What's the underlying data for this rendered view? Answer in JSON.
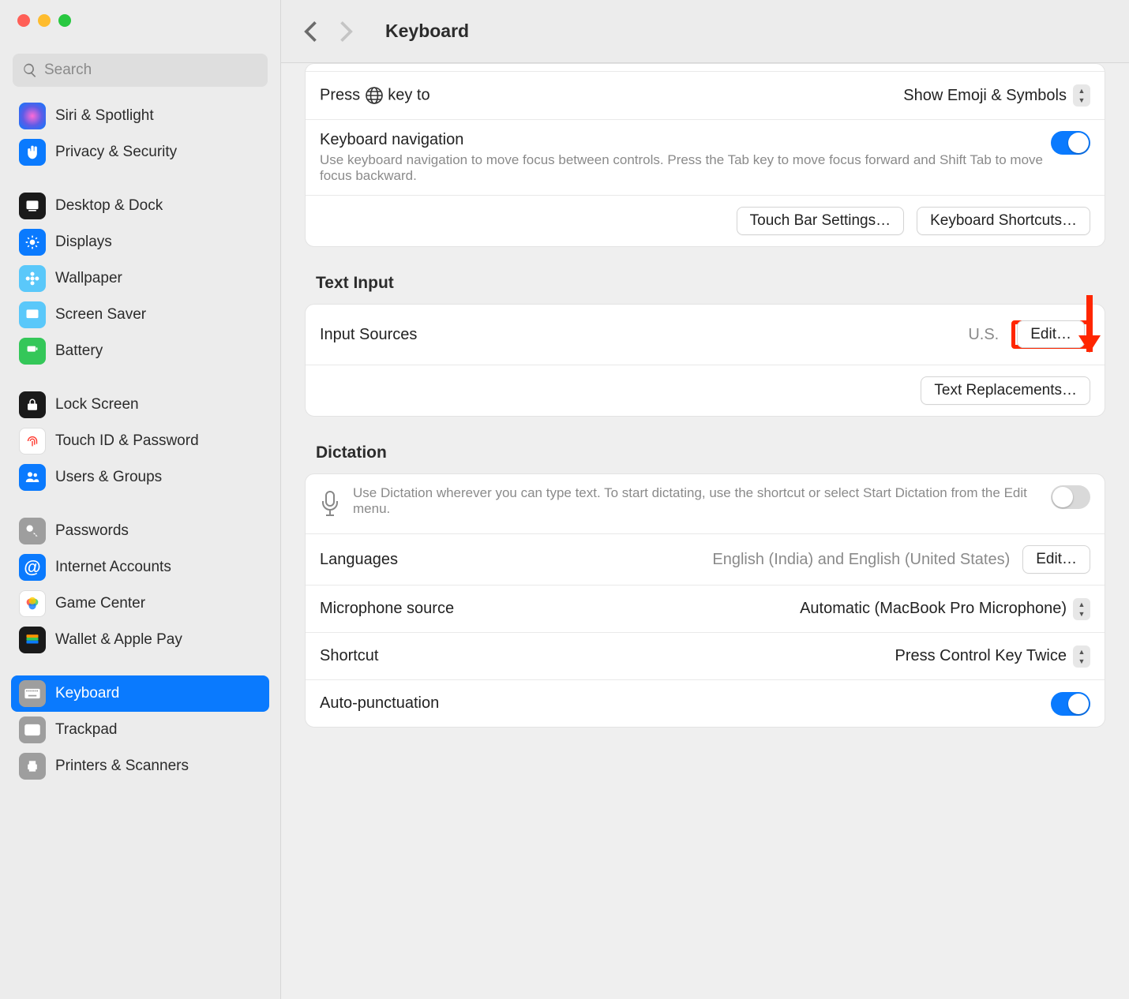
{
  "window": {
    "title": "Keyboard"
  },
  "search": {
    "placeholder": "Search"
  },
  "sidebar": {
    "groups": [
      [
        {
          "label": "Siri & Spotlight",
          "iconColor": "#1a1a1a",
          "icon": "siri"
        },
        {
          "label": "Privacy & Security",
          "iconColor": "#0a7afe",
          "icon": "hand"
        }
      ],
      [
        {
          "label": "Desktop & Dock",
          "iconColor": "#1a1a1a",
          "icon": "dock"
        },
        {
          "label": "Displays",
          "iconColor": "#0a7afe",
          "icon": "sun"
        },
        {
          "label": "Wallpaper",
          "iconColor": "#5ac8fa",
          "icon": "flower"
        },
        {
          "label": "Screen Saver",
          "iconColor": "#5ac8fa",
          "icon": "screensaver"
        },
        {
          "label": "Battery",
          "iconColor": "#34c759",
          "icon": "battery"
        }
      ],
      [
        {
          "label": "Lock Screen",
          "iconColor": "#1a1a1a",
          "icon": "lock"
        },
        {
          "label": "Touch ID & Password",
          "iconColor": "#ffffff",
          "icon": "fingerprint"
        },
        {
          "label": "Users & Groups",
          "iconColor": "#0a7afe",
          "icon": "users"
        }
      ],
      [
        {
          "label": "Passwords",
          "iconColor": "#9e9e9e",
          "icon": "key"
        },
        {
          "label": "Internet Accounts",
          "iconColor": "#0a7afe",
          "icon": "at"
        },
        {
          "label": "Game Center",
          "iconColor": "#ffffff",
          "icon": "gamecenter"
        },
        {
          "label": "Wallet & Apple Pay",
          "iconColor": "#1a1a1a",
          "icon": "wallet"
        }
      ],
      [
        {
          "label": "Keyboard",
          "iconColor": "#9e9e9e",
          "icon": "keyboard",
          "selected": true
        },
        {
          "label": "Trackpad",
          "iconColor": "#9e9e9e",
          "icon": "trackpad"
        },
        {
          "label": "Printers & Scanners",
          "iconColor": "#9e9e9e",
          "icon": "printer"
        }
      ]
    ]
  },
  "main": {
    "globe_label_pre": "Press",
    "globe_label_post": "key to",
    "globe_value": "Show Emoji & Symbols",
    "kbnav": {
      "title": "Keyboard navigation",
      "desc": "Use keyboard navigation to move focus between controls. Press the Tab key to move focus forward and Shift Tab to move focus backward.",
      "on": true
    },
    "touchbar_btn": "Touch Bar Settings…",
    "shortcuts_btn": "Keyboard Shortcuts…",
    "text_input": {
      "title": "Text Input",
      "input_sources_label": "Input Sources",
      "input_sources_value": "U.S.",
      "edit_btn": "Edit…",
      "replacements_btn": "Text Replacements…"
    },
    "dictation": {
      "title": "Dictation",
      "desc": "Use Dictation wherever you can type text. To start dictating, use the shortcut or select Start Dictation from the Edit menu.",
      "on": false,
      "languages_label": "Languages",
      "languages_value": "English (India) and English (United States)",
      "edit_btn": "Edit…",
      "mic_label": "Microphone source",
      "mic_value": "Automatic (MacBook Pro Microphone)",
      "shortcut_label": "Shortcut",
      "shortcut_value": "Press Control Key Twice",
      "autopunct_label": "Auto-punctuation",
      "autopunct_on": true
    }
  }
}
